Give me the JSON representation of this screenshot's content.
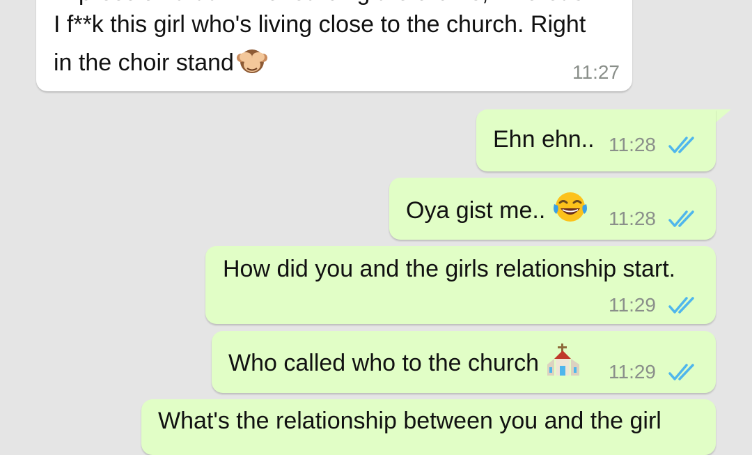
{
  "messages": [
    {
      "direction": "in",
      "lines": [
        "impression that I'm rehearsing the drums, whereas",
        "I f**k this girl who's living close to the church. Right",
        "in the choir stand"
      ],
      "emoji": "see-no-evil-monkey",
      "time": "11:27"
    },
    {
      "direction": "out",
      "text": "Ehn ehn..",
      "time": "11:28",
      "status": "read"
    },
    {
      "direction": "out",
      "text": "Oya gist me..",
      "emoji": "face-with-tears-of-joy",
      "time": "11:28",
      "status": "read"
    },
    {
      "direction": "out",
      "text": "How did you and the girls relationship start.",
      "time": "11:29",
      "status": "read"
    },
    {
      "direction": "out",
      "text": "Who called who to the church",
      "emoji": "church",
      "time": "11:29",
      "status": "read"
    },
    {
      "direction": "out",
      "text": "What's the relationship between you and the girl",
      "status": "read"
    }
  ],
  "colors": {
    "background": "#e5e5e5",
    "incoming_bubble": "#ffffff",
    "outgoing_bubble": "#e1fec6",
    "read_ticks": "#4fb6ec",
    "timestamp": "#8a8f8a"
  }
}
